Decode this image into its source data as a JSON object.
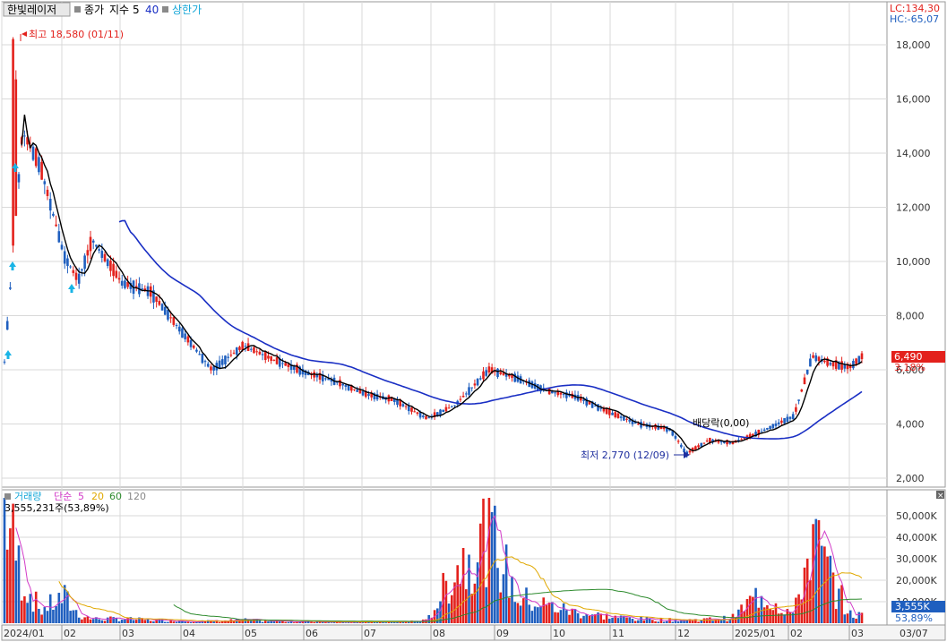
{
  "header": {
    "stock_name": "한빛레이저",
    "price_label": "종가",
    "ma_label": "지수",
    "ma1": "5",
    "ma2": "40",
    "limit_label": "상한가",
    "lc": "LC:134,30",
    "hc": "HC:-65,07"
  },
  "price_panel": {
    "high_note": "최고 18,580 (01/11)",
    "low_note": "최저 2,770 (12/09)",
    "dividend_note": "배당락(0,00)",
    "current_price": "6,490",
    "current_change": "3,18%",
    "y_ticks": [
      "18,000",
      "16,000",
      "14,000",
      "12,000",
      "10,000",
      "8,000",
      "6,000",
      "4,000",
      "2,000"
    ]
  },
  "volume_panel": {
    "title": "거래량",
    "ma_type": "단순",
    "ma_periods": [
      "5",
      "20",
      "60",
      "120"
    ],
    "current_volume": "3,555,231주(53,89%)",
    "current_volume_badge": "3,555K",
    "current_volume_pct": "53,89%",
    "y_ticks": [
      "50,000K",
      "40,000K",
      "30,000K",
      "20,000K",
      "10,000K"
    ]
  },
  "x_axis": {
    "labels": [
      "2024/01",
      "02",
      "03",
      "04",
      "05",
      "06",
      "07",
      "08",
      "09",
      "10",
      "11",
      "12",
      "2025/01",
      "02",
      "03",
      "03/07"
    ]
  },
  "colors": {
    "up": "#e3211c",
    "down": "#1f5fbf",
    "ma_short": "#000000",
    "ma_long": "#1a2fc4",
    "vol_ma5": "#d23cc8",
    "vol_ma20": "#e0a800",
    "vol_ma60": "#2e8b2e",
    "vol_ma120": "#888888",
    "grid": "#d9d9d9",
    "badge_price": "#e3211c",
    "badge_volume": "#1f5fbf"
  },
  "chart_data": {
    "type": "candlestick",
    "x": [
      "2024/01/02",
      "2024/01/11",
      "2024/01/20",
      "2024/02/01",
      "2024/02/08",
      "2024/02/15",
      "2024/03/01",
      "2024/03/15",
      "2024/04/01",
      "2024/04/15",
      "2024/05/01",
      "2024/05/15",
      "2024/06/01",
      "2024/06/15",
      "2024/07/01",
      "2024/07/15",
      "2024/08/01",
      "2024/08/15",
      "2024/09/01",
      "2024/09/15",
      "2024/10/01",
      "2024/10/15",
      "2024/11/01",
      "2024/11/15",
      "2024/12/01",
      "2024/12/09",
      "2024/12/20",
      "2025/01/01",
      "2025/01/15",
      "2025/02/01",
      "2025/02/10",
      "2025/02/20",
      "2025/03/01",
      "2025/03/07"
    ],
    "close": [
      6300,
      14800,
      13500,
      10200,
      9300,
      10800,
      9200,
      8900,
      7300,
      6000,
      6900,
      6400,
      5900,
      5600,
      5100,
      4900,
      4200,
      4700,
      6000,
      5700,
      5200,
      5000,
      4400,
      4000,
      3800,
      2900,
      3400,
      3300,
      3700,
      4300,
      6500,
      6200,
      6100,
      6490
    ],
    "volume_k": [
      55000,
      20000,
      6000,
      12000,
      4000,
      2000,
      2000,
      1500,
      1200,
      900,
      1500,
      1000,
      800,
      700,
      700,
      600,
      1200,
      25000,
      43000,
      12000,
      8000,
      5000,
      3000,
      2000,
      1500,
      1500,
      1800,
      2500,
      14000,
      4000,
      40000,
      20000,
      4000,
      3555
    ],
    "ylim": [
      2000,
      19000
    ],
    "volume_ylim": [
      0,
      58000
    ],
    "high": {
      "value": 18580,
      "date": "01/11"
    },
    "low": {
      "value": 2770,
      "date": "12/09"
    }
  }
}
